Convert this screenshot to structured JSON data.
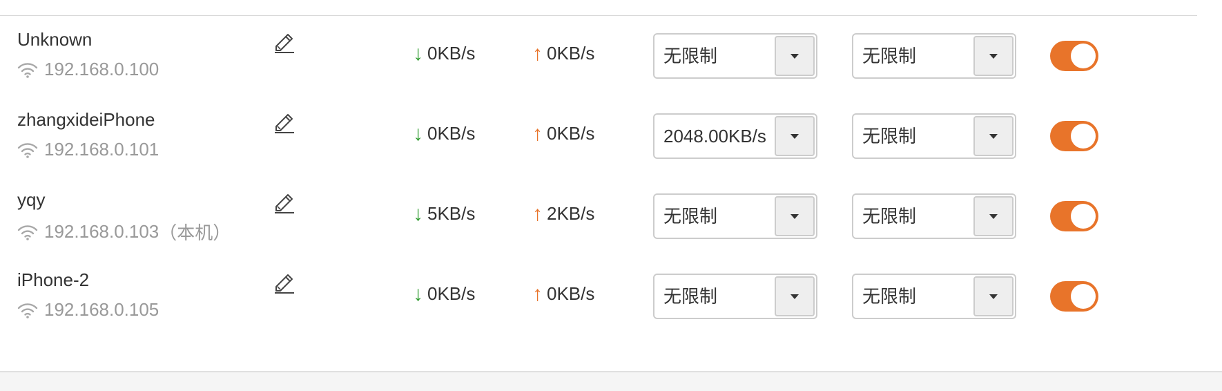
{
  "colors": {
    "accent": "#e8742a",
    "download_arrow": "#2e9b2e",
    "upload_arrow": "#e8742a",
    "muted_text": "#999999",
    "border": "#cccccc"
  },
  "icons": {
    "edit": "pencil-icon",
    "wifi": "wifi-icon",
    "download": "arrow-down-icon",
    "upload": "arrow-up-icon",
    "dropdown": "caret-down-icon"
  },
  "devices": [
    {
      "name": "Unknown",
      "ip": "192.168.0.100",
      "ip_suffix": "",
      "download_rate": "0KB/s",
      "upload_rate": "0KB/s",
      "download_limit": "无限制",
      "upload_limit": "无限制",
      "enabled": true
    },
    {
      "name": "zhangxideiPhone",
      "ip": "192.168.0.101",
      "ip_suffix": "",
      "download_rate": "0KB/s",
      "upload_rate": "0KB/s",
      "download_limit": "2048.00KB/s",
      "upload_limit": "无限制",
      "enabled": true
    },
    {
      "name": "yqy",
      "ip": "192.168.0.103",
      "ip_suffix": "（本机）",
      "download_rate": "5KB/s",
      "upload_rate": "2KB/s",
      "download_limit": "无限制",
      "upload_limit": "无限制",
      "enabled": true
    },
    {
      "name": "iPhone-2",
      "ip": "192.168.0.105",
      "ip_suffix": "",
      "download_rate": "0KB/s",
      "upload_rate": "0KB/s",
      "download_limit": "无限制",
      "upload_limit": "无限制",
      "enabled": true
    }
  ]
}
